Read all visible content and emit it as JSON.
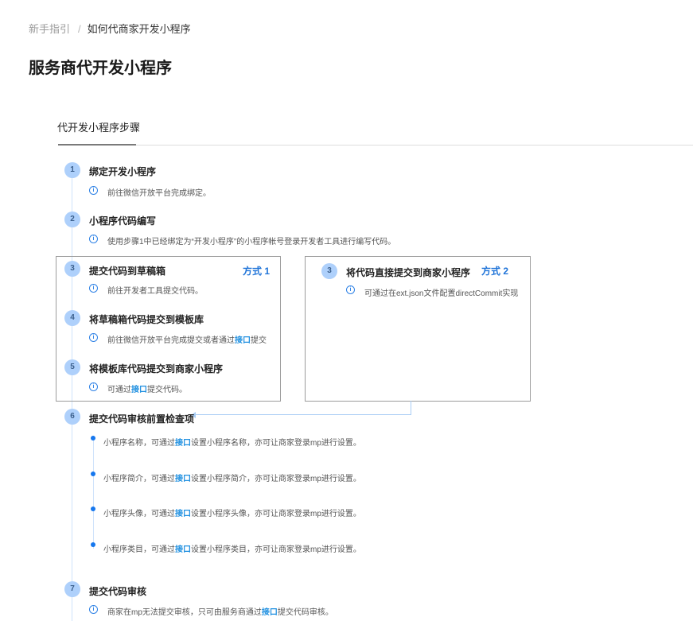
{
  "breadcrumb": {
    "parent": "新手指引",
    "separator": "/",
    "current": "如何代商家开发小程序"
  },
  "page_title": "服务商代开发小程序",
  "tab": {
    "label": "代开发小程序步骤"
  },
  "steps": {
    "s1": {
      "num": "1",
      "title": "绑定开发小程序",
      "desc": "前往微信开放平台完成绑定。"
    },
    "s2": {
      "num": "2",
      "title": "小程序代码编写",
      "desc": "使用步骤1中已经绑定为“开发小程序”的小程序帐号登录开发者工具进行编写代码。"
    },
    "s3a": {
      "num": "3",
      "title": "提交代码到草稿箱",
      "way": "方式 1",
      "desc": "前往开发者工具提交代码。"
    },
    "s4": {
      "num": "4",
      "title": "将草稿箱代码提交到模板库",
      "desc_pre": "前往微信开放平台完成提交或者通过",
      "link": "接口",
      "desc_post": "提交"
    },
    "s5": {
      "num": "5",
      "title": "将模板库代码提交到商家小程序",
      "desc_pre": "可通过",
      "link": "接口",
      "desc_post": "提交代码。"
    },
    "s3b": {
      "num": "3",
      "title": "将代码直接提交到商家小程序",
      "way": "方式 2",
      "desc": "可通过在ext.json文件配置directCommit实现"
    },
    "s6": {
      "num": "6",
      "title": "提交代码审核前置检查项",
      "items": [
        {
          "pre": "小程序名称，可通过",
          "link": "接口",
          "post": "设置小程序名称，亦可让商家登录mp进行设置。"
        },
        {
          "pre": "小程序简介，可通过",
          "link": "接口",
          "post": "设置小程序简介，亦可让商家登录mp进行设置。"
        },
        {
          "pre": "小程序头像，可通过",
          "link": "接口",
          "post": "设置小程序头像，亦可让商家登录mp进行设置。"
        },
        {
          "pre": "小程序类目，可通过",
          "link": "接口",
          "post": "设置小程序类目，亦可让商家登录mp进行设置。"
        }
      ]
    },
    "s7": {
      "num": "7",
      "title": "提交代码审核",
      "desc_pre": "商家在mp无法提交审核，只可由服务商通过",
      "link": "接口",
      "desc_post": "提交代码审核。"
    }
  },
  "icons": {
    "info": "info-circle-icon",
    "arrow": "arrow-left-icon"
  },
  "colors": {
    "accent": "#1e73d8",
    "link": "#1e8fe0",
    "step_circle": "#aed0fb",
    "dot": "#1677ee"
  }
}
